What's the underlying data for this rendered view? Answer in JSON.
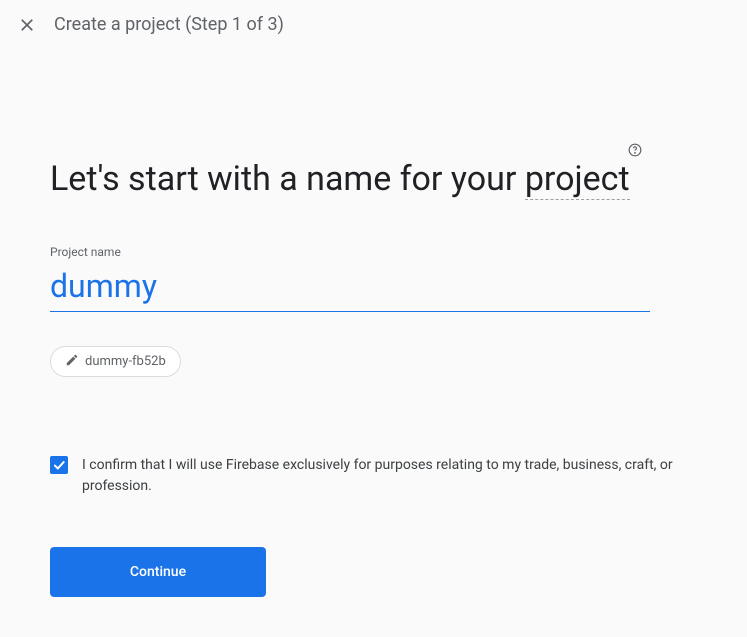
{
  "header": {
    "title": "Create a project (Step 1 of 3)"
  },
  "heading": {
    "prefix": "Let's start with a name for your ",
    "project_word": "project"
  },
  "form": {
    "project_name_label": "Project name",
    "project_name_value": "dummy",
    "project_id_chip": "dummy-fb52b",
    "confirm_text": "I confirm that I will use Firebase exclusively for purposes relating to my trade, business, craft, or profession.",
    "confirm_checked": true,
    "continue_label": "Continue"
  }
}
